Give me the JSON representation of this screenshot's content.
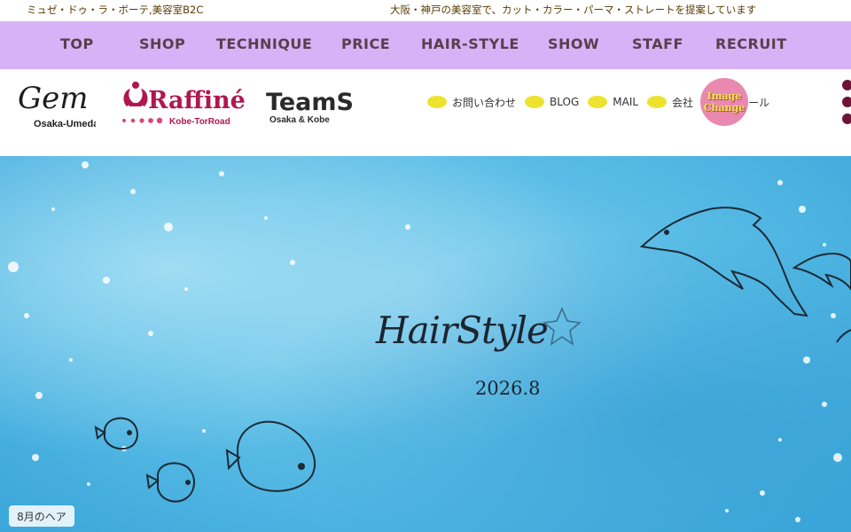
{
  "topbar": {
    "left_text": "ミュゼ・ドゥ・ラ・ボーテ,美容室B2C",
    "right_text": "大阪・神戸の美容室で、カット・カラー・パーマ・ストレートを提案しています"
  },
  "nav": {
    "items": [
      "TOP",
      "SHOP",
      "TECHNIQUE",
      "PRICE",
      "HAIR-STYLE",
      "SHOW",
      "STAFF",
      "RECRUIT"
    ]
  },
  "logos": {
    "gem": {
      "name": "Gem",
      "sub": "Osaka-Umeda"
    },
    "raffine": {
      "name": "Raffiné",
      "sub": "Kobe-TorRoad"
    },
    "teams": {
      "name": "TeamS",
      "sub": "Osaka & Kobe"
    }
  },
  "links": [
    {
      "label": "お問い合わせ",
      "icon": "yellow-dot-icon"
    },
    {
      "label": "BLOG",
      "icon": "yellow-dot-icon"
    },
    {
      "label": "MAIL",
      "icon": "yellow-dot-icon"
    },
    {
      "label": "会社",
      "icon": "yellow-dot-icon"
    },
    {
      "label": "スクール",
      "icon": "yellow-dot-icon"
    }
  ],
  "image_change": {
    "line1": "Image",
    "line2": "Change"
  },
  "hero": {
    "title": "HairStyle",
    "date": "2026.8",
    "badge": "8月のヘア"
  },
  "colors": {
    "nav_bg": "#d7b2f6",
    "nav_text": "#5a3e4e",
    "dot": "#ede32e",
    "menu_dots": "#6e1338",
    "raffine_accent": "#b0174f"
  }
}
